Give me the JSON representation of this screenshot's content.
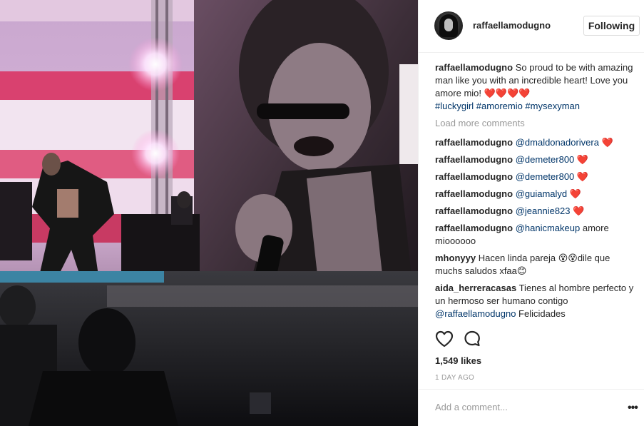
{
  "post": {
    "photo_icon": "concert-photo",
    "header": {
      "username": "raffaellamodugno",
      "follow_label": "Following"
    },
    "caption": {
      "username": "raffaellamodugno",
      "text": "So proud to be with amazing man like you with an incredible heart! Love you amore mio! ",
      "hearts": "❤️❤️❤️❤️",
      "hashtags": "#luckygirl #amoremio #mysexyman"
    },
    "load_more": "Load more comments",
    "comments": [
      {
        "username": "raffaellamodugno",
        "mention": "@dmaldonadorivera",
        "text": "",
        "suffix": "❤️"
      },
      {
        "username": "raffaellamodugno",
        "mention": "@demeter800",
        "text": "",
        "suffix": "❤️"
      },
      {
        "username": "raffaellamodugno",
        "mention": "@demeter800",
        "text": "",
        "suffix": "❤️"
      },
      {
        "username": "raffaellamodugno",
        "mention": "@guiamalyd",
        "text": "",
        "suffix": "❤️"
      },
      {
        "username": "raffaellamodugno",
        "mention": "@jeannie823",
        "text": "",
        "suffix": "❤️"
      },
      {
        "username": "raffaellamodugno",
        "mention": "@hanicmakeup",
        "text": " amore mioooooo",
        "suffix": ""
      },
      {
        "username": "mhonyyy",
        "mention": "",
        "text": "Hacen linda pareja 😵😵dile que muchs saludos xfaa😊",
        "suffix": ""
      },
      {
        "username": "aida_herreracasas",
        "mention": "",
        "text": "Tienes al hombre perfecto y un hermoso ser humano contigo ",
        "mention_after": "@raffaellamodugno",
        "text_after": " Felicidades",
        "suffix": ""
      }
    ],
    "actions": {
      "like_icon": "heart-outline-icon",
      "comment_icon": "comment-bubble-icon"
    },
    "likes": "1,549 likes",
    "time": "1 DAY AGO",
    "add_comment_placeholder": "Add a comment...",
    "more_label": "•••",
    "colors": {
      "link": "#003569",
      "muted": "#999999",
      "border": "#efefef",
      "heart": "#ed1c24"
    }
  }
}
